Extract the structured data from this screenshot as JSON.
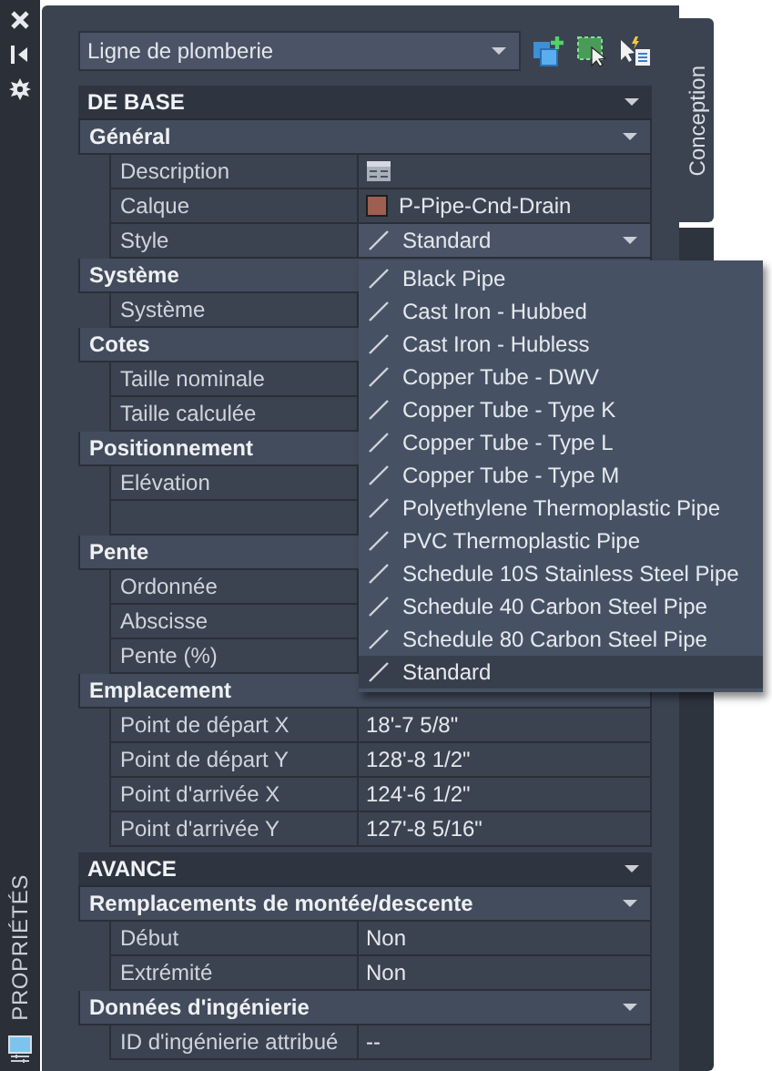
{
  "strip": {
    "title": "PROPRIÉTÉS"
  },
  "toolbar": {
    "object_type": "Ligne de plomberie"
  },
  "side_tabs": [
    {
      "label": "Conception",
      "selected": true
    }
  ],
  "sections": [
    {
      "title": "DE BASE",
      "expanded": true,
      "categories": [
        {
          "title": "Général",
          "expanded": true,
          "rows": [
            {
              "label": "Description",
              "kind": "editor"
            },
            {
              "label": "Calque",
              "kind": "layer",
              "value": "P-Pipe-Cnd-Drain",
              "color": "#9c5f50"
            },
            {
              "label": "Style",
              "kind": "combo",
              "value": "Standard",
              "expanded": true
            }
          ]
        },
        {
          "title": "Système",
          "expanded": true,
          "rows": [
            {
              "label": "Système",
              "kind": "text"
            }
          ]
        },
        {
          "title": "Cotes",
          "expanded": true,
          "rows": [
            {
              "label": "Taille nominale",
              "kind": "text"
            },
            {
              "label": "Taille calculée",
              "kind": "text"
            }
          ]
        },
        {
          "title": "Positionnement",
          "expanded": true,
          "rows": [
            {
              "label": "Elévation",
              "kind": "text"
            },
            {
              "kind": "blank"
            }
          ]
        },
        {
          "title": "Pente",
          "expanded": true,
          "rows": [
            {
              "label": "Ordonnée",
              "kind": "text"
            },
            {
              "label": "Abscisse",
              "kind": "text"
            },
            {
              "label": "Pente (%)",
              "kind": "text"
            }
          ]
        },
        {
          "title": "Emplacement",
          "expanded": true,
          "rows": [
            {
              "label": "Point de départ X",
              "kind": "text",
              "value": "18'-7 5/8\""
            },
            {
              "label": "Point de départ Y",
              "kind": "text",
              "value": "128'-8 1/2\""
            },
            {
              "label": "Point d'arrivée X",
              "kind": "text",
              "value": "124'-6 1/2\""
            },
            {
              "label": "Point d'arrivée Y",
              "kind": "text",
              "value": "127'-8 5/16\""
            }
          ]
        }
      ]
    },
    {
      "title": "AVANCE",
      "expanded": true,
      "categories": [
        {
          "title": "Remplacements de montée/descente",
          "expanded": true,
          "rows": [
            {
              "label": "Début",
              "kind": "text",
              "value": "Non"
            },
            {
              "label": "Extrémité",
              "kind": "text",
              "value": "Non"
            }
          ]
        },
        {
          "title": "Données d'ingénierie",
          "expanded": true,
          "rows": [
            {
              "label": "ID d'ingénierie attribué",
              "kind": "text",
              "value": "--"
            }
          ]
        }
      ]
    }
  ],
  "style_menu": {
    "items": [
      {
        "label": "Black Pipe",
        "selected": false
      },
      {
        "label": "Cast Iron - Hubbed",
        "selected": false
      },
      {
        "label": "Cast Iron - Hubless",
        "selected": false
      },
      {
        "label": "Copper Tube - DWV",
        "selected": false
      },
      {
        "label": "Copper Tube - Type K",
        "selected": false
      },
      {
        "label": "Copper Tube - Type L",
        "selected": false
      },
      {
        "label": "Copper Tube - Type M",
        "selected": false
      },
      {
        "label": "Polyethylene Thermoplastic Pipe",
        "selected": false
      },
      {
        "label": "PVC Thermoplastic Pipe",
        "selected": false
      },
      {
        "label": "Schedule 10S Stainless Steel Pipe",
        "selected": false
      },
      {
        "label": "Schedule 40 Carbon Steel Pipe",
        "selected": false
      },
      {
        "label": "Schedule 80 Carbon Steel Pipe",
        "selected": false
      },
      {
        "label": "Standard",
        "selected": true
      }
    ]
  }
}
